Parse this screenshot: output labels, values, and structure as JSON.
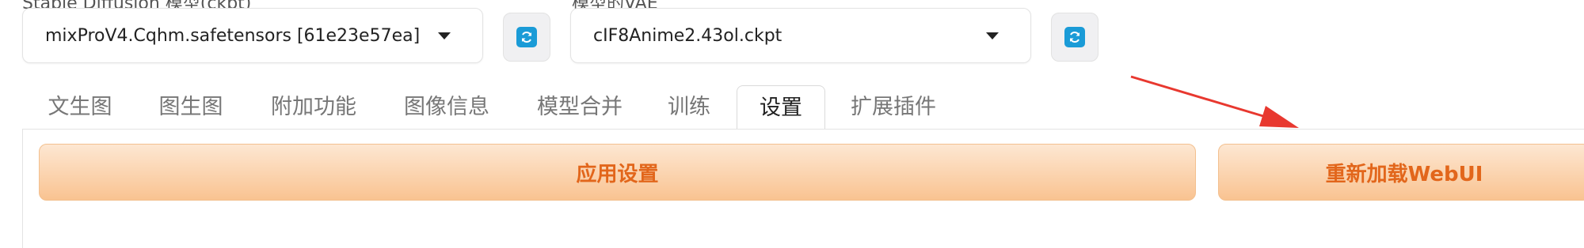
{
  "top_labels": {
    "model_label": "Stable Diffusion 模型(ckpt)",
    "vae_label": "模型的VAE"
  },
  "model_select": {
    "value": "mixProV4.Cqhm.safetensors [61e23e57ea]"
  },
  "vae_select": {
    "value": "cIF8Anime2.43ol.ckpt"
  },
  "tabs": [
    {
      "label": "文生图"
    },
    {
      "label": "图生图"
    },
    {
      "label": "附加功能"
    },
    {
      "label": "图像信息"
    },
    {
      "label": "模型合并"
    },
    {
      "label": "训练"
    },
    {
      "label": "设置",
      "active": true
    },
    {
      "label": "扩展插件"
    }
  ],
  "settings": {
    "apply_label": "应用设置",
    "reload_label": "重新加载WebUI"
  },
  "icons": {
    "refresh": "refresh-icon",
    "dropdown": "chevron-down-icon"
  },
  "colors": {
    "accent_text": "#e2661b",
    "button_gradient_top": "#fde7d2",
    "button_gradient_bottom": "#f9c391",
    "refresh_icon": "#1a9bd7",
    "annotation_arrow": "#e8382f"
  }
}
